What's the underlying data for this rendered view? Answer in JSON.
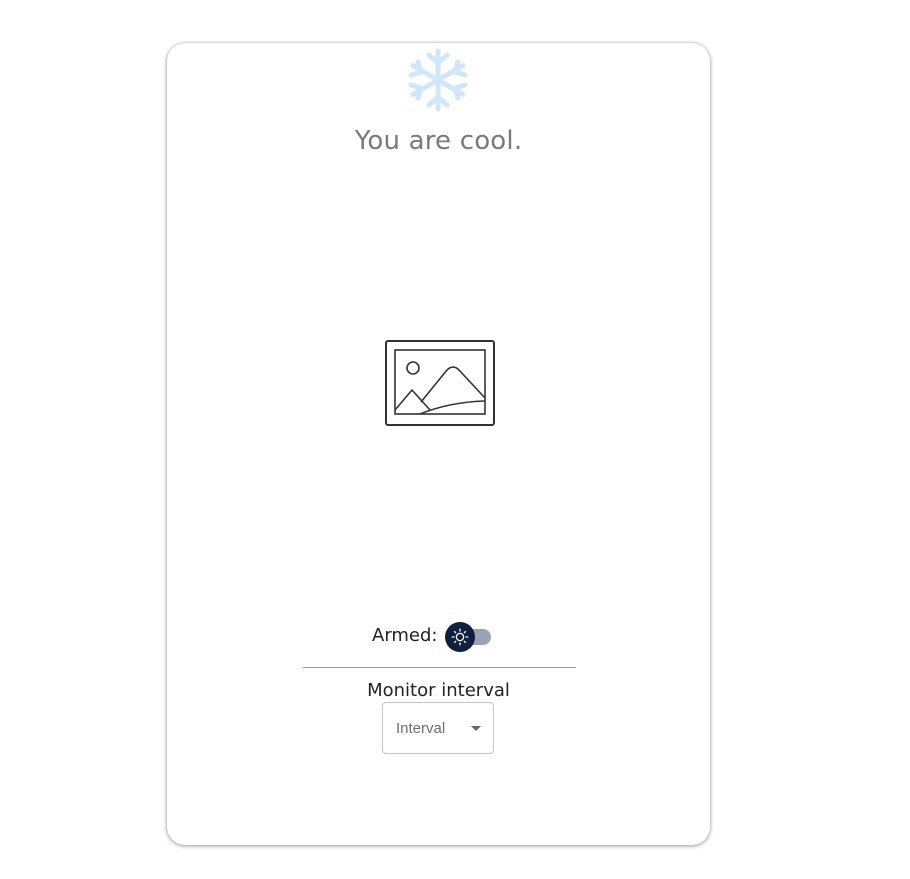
{
  "status": {
    "message": "You are cool.",
    "icon": "snowflake-icon",
    "icon_color": "#cfe6fb"
  },
  "image": {
    "icon": "image-placeholder-icon"
  },
  "armed": {
    "label": "Armed:",
    "checked": false,
    "thumb_icon": "sun-icon",
    "thumb_color": "#0f1f3d",
    "track_color": "#9aa3b5"
  },
  "monitor": {
    "label": "Monitor interval",
    "select_value": "Interval"
  }
}
